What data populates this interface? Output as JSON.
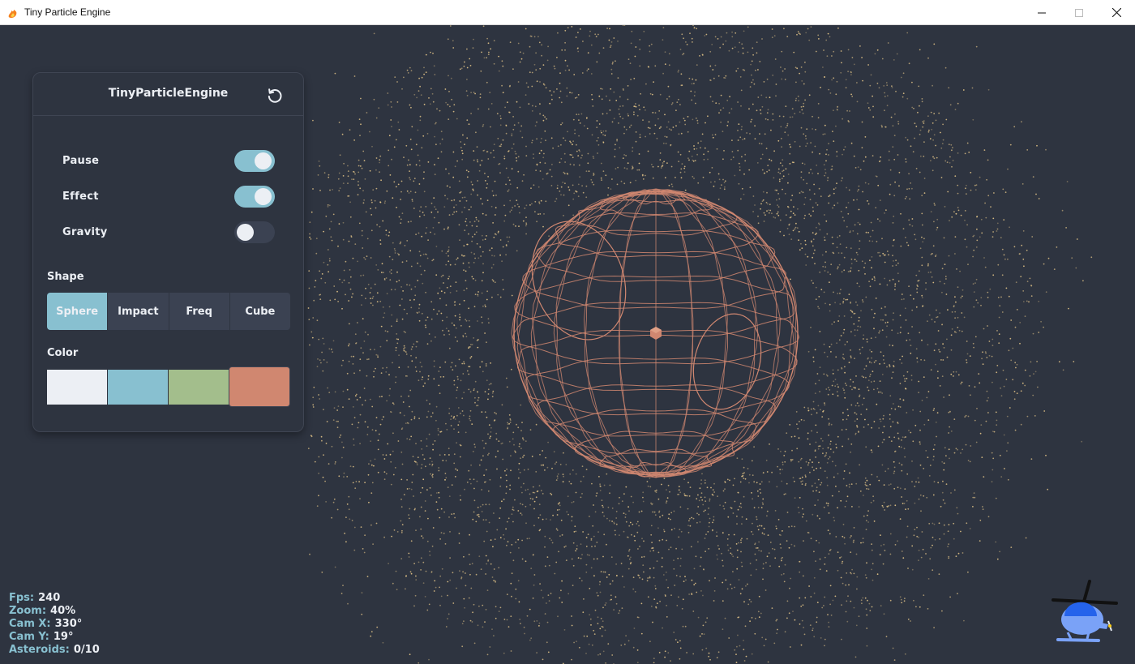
{
  "window": {
    "title": "Tiny Particle Engine",
    "app_icon": "flame-icon"
  },
  "panel": {
    "title": "TinyParticleEngine",
    "reset_icon": "refresh-icon",
    "toggles": [
      {
        "label": "Pause",
        "on": true
      },
      {
        "label": "Effect",
        "on": true
      },
      {
        "label": "Gravity",
        "on": false
      }
    ],
    "shape_label": "Shape",
    "shapes": [
      "Sphere",
      "Impact",
      "Freq",
      "Cube"
    ],
    "selected_shape": "Sphere",
    "color_label": "Color",
    "colors": [
      "#eceff4",
      "#88c0d0",
      "#a3be8c",
      "#d08770"
    ],
    "selected_color": "#d08770"
  },
  "stats": {
    "fps_label": "Fps:",
    "fps": "240",
    "zoom_label": "Zoom:",
    "zoom": "40%",
    "camx_label": "Cam X:",
    "camx": "330°",
    "camy_label": "Cam Y:",
    "camy": "19°",
    "asteroids_label": "Asteroids:",
    "asteroids": "0/10"
  },
  "theme": {
    "background": "#2e3440",
    "accent": "#88c0d0",
    "particle_color": "#ebcb8b",
    "wireframe_color": "#d08770"
  },
  "corner_icon": "helicopter-icon"
}
